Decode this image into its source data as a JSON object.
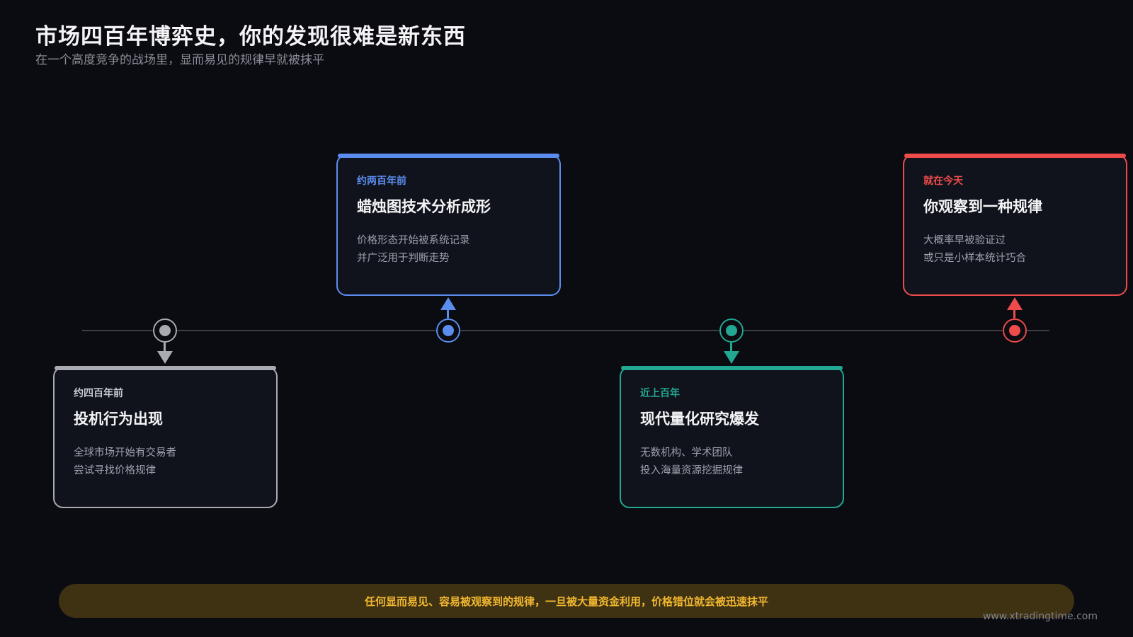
{
  "header": {
    "title": "市场四百年博弈史，你的发现很难是新东西",
    "subtitle": "在一个高度竞争的战场里，显而易见的规律早就被抹平"
  },
  "events": [
    {
      "era": "约四百年前",
      "heading": "投机行为出现",
      "desc": [
        "全球市场开始有交易者",
        "尝试寻找价格规律"
      ],
      "color": "#a9abb2",
      "era_color": "#c6c8ce",
      "position": "below"
    },
    {
      "era": "约两百年前",
      "heading": "蜡烛图技术分析成形",
      "desc": [
        "价格形态开始被系统记录",
        "并广泛用于判断走势"
      ],
      "color": "#5b8def",
      "era_color": "#5b8def",
      "position": "above"
    },
    {
      "era": "近上百年",
      "heading": "现代量化研究爆发",
      "desc": [
        "无数机构、学术团队",
        "投入海量资源挖掘规律"
      ],
      "color": "#22a892",
      "era_color": "#22a892",
      "position": "below"
    },
    {
      "era": "就在今天",
      "heading": "你观察到一种规律",
      "desc": [
        "大概率早被验证过",
        "或只是小样本统计巧合"
      ],
      "color": "#ee4b4b",
      "era_color": "#ee4b4b",
      "position": "above"
    }
  ],
  "banner": {
    "text": "任何显而易见、容易被观察到的规律，一旦被大量资金利用，价格错位就会被迅速抹平"
  },
  "footer": {
    "url": "www.xtradingtime.com"
  }
}
